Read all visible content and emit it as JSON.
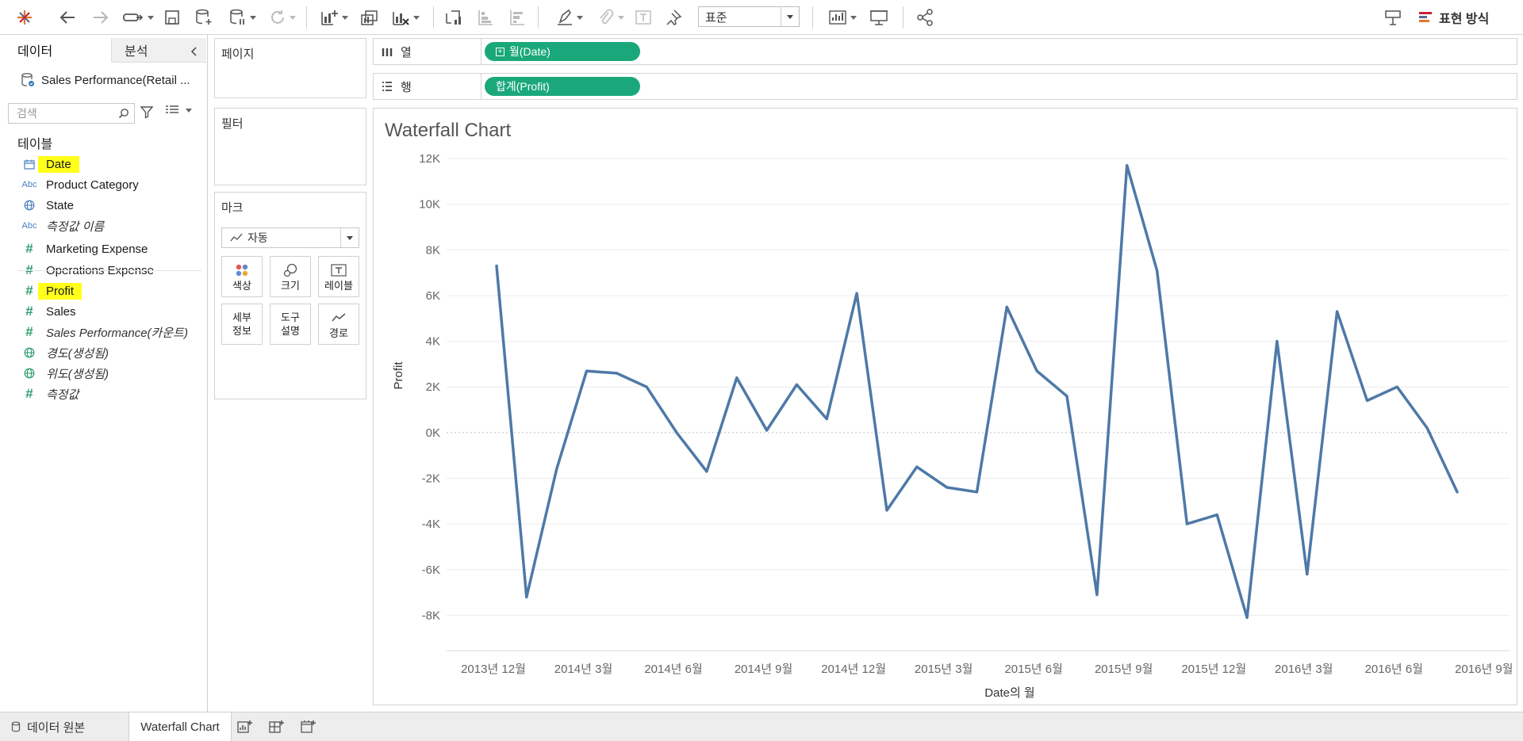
{
  "toolbar": {
    "icons": [
      "tableau-logo-icon",
      "undo-icon",
      "redo-icon",
      "redirect-icon",
      "save-icon",
      "new-datasource-icon",
      "pause-updates-icon",
      "refresh-icon",
      "new-worksheet-icon",
      "duplicate-icon",
      "clear-sheet-icon",
      "swap-icon",
      "sort-ascending-icon",
      "sort-descending-icon",
      "highlight-icon",
      "group-icon",
      "labels-icon",
      "pin-icon",
      "show-cards-icon",
      "presentation-icon",
      "share-icon",
      "tooltip-toggle-icon",
      "show-me-icon"
    ],
    "fit_select": "표준",
    "show_me_label": "표현 방식"
  },
  "datapane": {
    "tabs": {
      "data": "데이터",
      "analysis": "분석"
    },
    "datasource_name": "Sales Performance(Retail ...",
    "search": {
      "placeholder": "검색",
      "value": ""
    },
    "tables_heading": "테이블",
    "fields": [
      {
        "name": "Date",
        "type": "date",
        "highlighted": true,
        "italic": false
      },
      {
        "name": "Product Category",
        "type": "string",
        "highlighted": false,
        "italic": false
      },
      {
        "name": "State",
        "type": "geo",
        "highlighted": false,
        "italic": false
      },
      {
        "name": "측정값 이름",
        "type": "string",
        "highlighted": false,
        "italic": true
      },
      {
        "name": "Marketing Expense",
        "type": "number",
        "highlighted": false,
        "italic": false
      },
      {
        "name": "Operations Expense",
        "type": "number",
        "highlighted": false,
        "italic": false
      },
      {
        "name": "Profit",
        "type": "number",
        "highlighted": true,
        "italic": false
      },
      {
        "name": "Sales",
        "type": "number",
        "highlighted": false,
        "italic": false
      },
      {
        "name": "Sales Performance(카운트)",
        "type": "number",
        "highlighted": false,
        "italic": true
      },
      {
        "name": "경도(생성됨)",
        "type": "geo",
        "highlighted": false,
        "italic": true
      },
      {
        "name": "위도(생성됨)",
        "type": "geo",
        "highlighted": false,
        "italic": true
      },
      {
        "name": "측정값",
        "type": "number",
        "highlighted": false,
        "italic": true
      }
    ],
    "type_icon_text": {
      "string": "Abc",
      "number": "#"
    }
  },
  "cards": {
    "pages": "페이지",
    "filters": "필터",
    "marks": "마크",
    "marks_type": "자동",
    "mark_buttons": {
      "color": "색상",
      "size": "크기",
      "label": "레이블",
      "detail_line1": "세부",
      "detail_line2": "정보",
      "tooltip_line1": "도구",
      "tooltip_line2": "설명",
      "path": "경로"
    }
  },
  "shelves": {
    "columns": {
      "label": "열",
      "pill": "월(Date)"
    },
    "rows": {
      "label": "행",
      "pill": "합계(Profit)"
    }
  },
  "view": {
    "title": "Waterfall Chart"
  },
  "bottom": {
    "datasource_tab": "데이터 원본",
    "sheet_tab": "Waterfall Chart",
    "new_buttons": [
      "new-worksheet-icon",
      "new-dashboard-icon",
      "new-story-icon"
    ]
  },
  "colors": {
    "line": "#4e79a7",
    "pill": "#1aa87a",
    "highlight": "#ffff1a",
    "grid": "#ececec",
    "zero_line": "#bdbdbd"
  },
  "chart_data": {
    "type": "line",
    "title": "Waterfall Chart",
    "xlabel": "Date의 월",
    "ylabel": "Profit",
    "ylim": [
      -9200,
      12800
    ],
    "yticks": [
      12000,
      10000,
      8000,
      6000,
      4000,
      2000,
      0,
      -2000,
      -4000,
      -6000,
      -8000
    ],
    "ytick_labels": [
      "12K",
      "10K",
      "8K",
      "6K",
      "4K",
      "2K",
      "0K",
      "-2K",
      "-4K",
      "-6K",
      "-8K"
    ],
    "x": [
      "2013-12",
      "2014-01",
      "2014-02",
      "2014-03",
      "2014-04",
      "2014-05",
      "2014-06",
      "2014-07",
      "2014-08",
      "2014-09",
      "2014-10",
      "2014-11",
      "2014-12",
      "2015-01",
      "2015-02",
      "2015-03",
      "2015-04",
      "2015-05",
      "2015-06",
      "2015-07",
      "2015-08",
      "2015-09",
      "2015-10",
      "2015-11",
      "2015-12",
      "2016-01",
      "2016-02",
      "2016-03",
      "2016-04",
      "2016-05",
      "2016-06",
      "2016-07",
      "2016-08",
      "2016-09",
      "2016-10"
    ],
    "xtick_positions": [
      "2013-12",
      "2014-03",
      "2014-06",
      "2014-09",
      "2014-12",
      "2015-03",
      "2015-06",
      "2015-09",
      "2015-12",
      "2016-03",
      "2016-06",
      "2016-09"
    ],
    "xtick_labels": [
      "2013년 12월",
      "2014년 3월",
      "2014년 6월",
      "2014년 9월",
      "2014년 12월",
      "2015년 3월",
      "2015년 6월",
      "2015년 9월",
      "2015년 12월",
      "2016년 3월",
      "2016년 6월",
      "2016년 9월"
    ],
    "series": [
      {
        "values": [
          7300,
          -7200,
          -1600,
          2700,
          2600,
          2000,
          0,
          -1700,
          2400,
          100,
          2100,
          600,
          6100,
          -3400,
          -1500,
          -2400,
          -2600,
          5500,
          2700,
          1600,
          -7100,
          11700,
          7100,
          -4000,
          -3600,
          -8100,
          4000,
          -6200,
          5300,
          1400,
          2000,
          200,
          -2600,
          null,
          null
        ]
      }
    ],
    "zero_line": true,
    "grid": true,
    "legend": "none"
  }
}
